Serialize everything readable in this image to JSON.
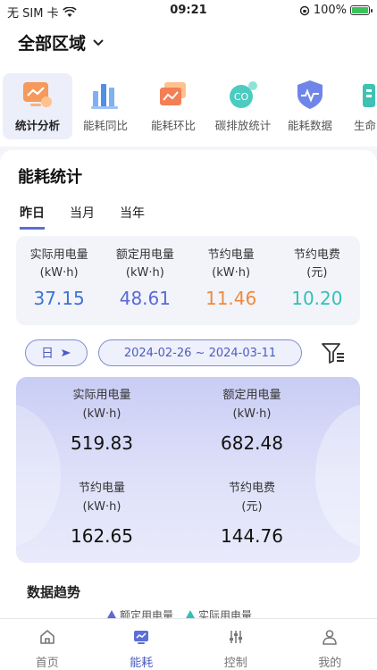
{
  "status_bar": {
    "carrier": "无 SIM 卡",
    "time": "09:21",
    "battery": "100%"
  },
  "header": {
    "region": "全部区域"
  },
  "categories": [
    {
      "label": "统计分析",
      "active": true
    },
    {
      "label": "能耗同比",
      "active": false
    },
    {
      "label": "能耗环比",
      "active": false
    },
    {
      "label": "碳排放统计",
      "active": false,
      "icon_text": "CO"
    },
    {
      "label": "能耗数据",
      "active": false
    },
    {
      "label": "生命",
      "active": false
    }
  ],
  "section": {
    "title": "能耗统计"
  },
  "period_tabs": [
    {
      "label": "昨日",
      "active": true
    },
    {
      "label": "当月",
      "active": false
    },
    {
      "label": "当年",
      "active": false
    }
  ],
  "stats": [
    {
      "title": "实际用电量",
      "unit": "(kW·h)",
      "value": "37.15",
      "color": "#3d73d4"
    },
    {
      "title": "额定用电量",
      "unit": "(kW·h)",
      "value": "48.61",
      "color": "#5b69d6"
    },
    {
      "title": "节约电量",
      "unit": "(kW·h)",
      "value": "11.46",
      "color": "#f08a3c"
    },
    {
      "title": "节约电费",
      "unit": "(元)",
      "value": "10.20",
      "color": "#33c1b6"
    }
  ],
  "date_filter": {
    "unit": "日",
    "range": "2024-02-26 ~ 2024-03-11"
  },
  "summary": [
    {
      "title": "实际用电量",
      "unit": "(kW·h)",
      "value": "519.83"
    },
    {
      "title": "额定用电量",
      "unit": "(kW·h)",
      "value": "682.48"
    },
    {
      "title": "节约电量",
      "unit": "(kW·h)",
      "value": "162.65"
    },
    {
      "title": "节约电费",
      "unit": "(元)",
      "value": "144.76"
    }
  ],
  "trend": {
    "title": "数据趋势",
    "legend": [
      {
        "label": "额定用电量",
        "color": "#5b69d6"
      },
      {
        "label": "实际用电量",
        "color": "#33c1b6"
      }
    ]
  },
  "tabbar": [
    {
      "label": "首页",
      "active": false
    },
    {
      "label": "能耗",
      "active": true
    },
    {
      "label": "控制",
      "active": false
    },
    {
      "label": "我的",
      "active": false
    }
  ]
}
